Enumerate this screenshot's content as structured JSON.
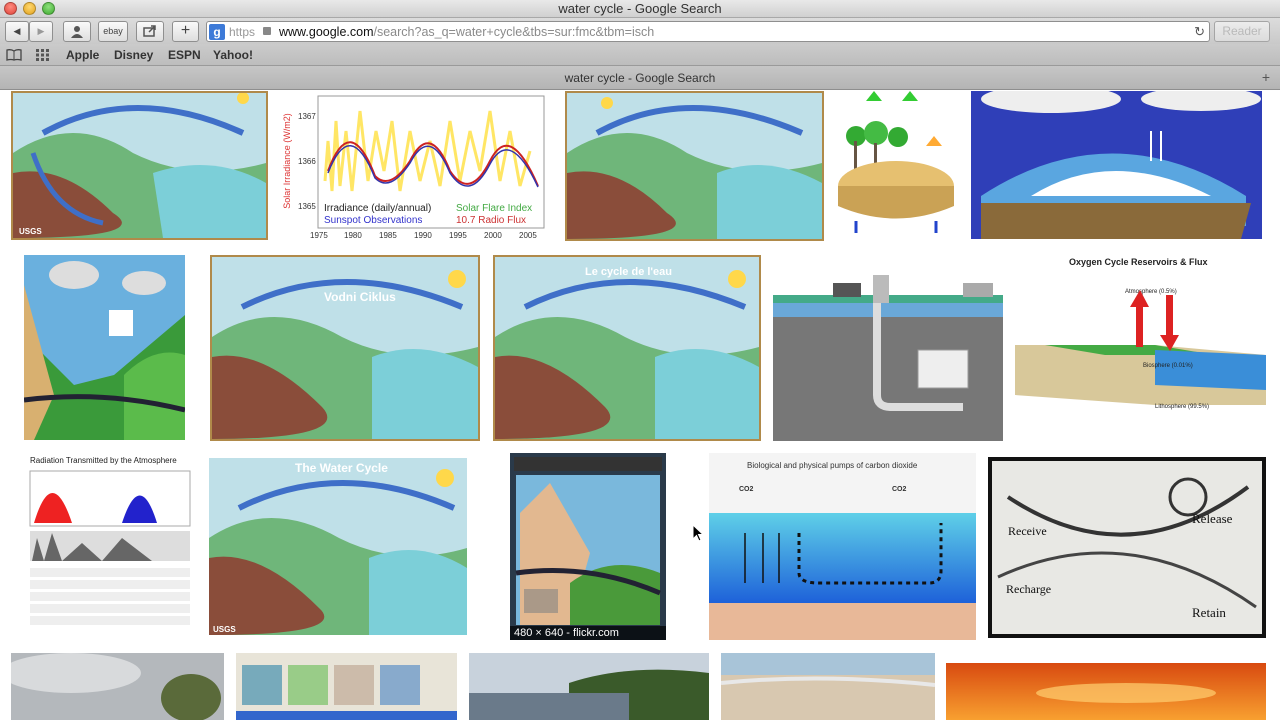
{
  "window": {
    "title": "water cycle - Google Search"
  },
  "toolbar": {
    "back_label": "◀",
    "forward_label": "▶",
    "ebay_label": "ebay",
    "url_scheme": "https",
    "url_host": "www.google.com",
    "url_rest": "/search?as_q=water+cycle&tbs=sur:fmc&tbm=isch",
    "reader_label": "Reader"
  },
  "bookmarks": {
    "items": [
      "Apple",
      "Disney",
      "ESPN",
      "Yahoo!"
    ]
  },
  "tab": {
    "label": "water cycle - Google Search"
  },
  "images": {
    "usgs_label": "USGS",
    "solar": {
      "ylabel": "Solar Irradiance (W/m2)",
      "yticks": [
        "1367",
        "1366",
        "1365"
      ],
      "xticks": [
        "1975",
        "1980",
        "1985",
        "1990",
        "1995",
        "2000",
        "2005"
      ],
      "legend_irr": "Irradiance (daily/annual)",
      "legend_flare": "Solar Flare Index",
      "legend_sunspot": "Sunspot Observations",
      "legend_radio": "10.7 Radio Flux"
    },
    "vodni_title": "Vodni Ciklus",
    "cycle_eau_title": "Le cycle de l'eau",
    "oxygen_title": "Oxygen Cycle Reservoirs & Flux",
    "oxygen_labels": [
      "Atmosphere (0.5%)",
      "Biosphere (0.01%)",
      "Lithosphere (99.5%)"
    ],
    "radiation_title": "Radiation Transmitted by the Atmosphere",
    "water_cycle_title": "The Water Cycle",
    "flickr_caption": "480 × 640 - flickr.com",
    "carbon_title": "Biological and physical pumps of carbon dioxide",
    "carbon_co2": "CO2",
    "poster_words": [
      "Receive",
      "Release",
      "Recharge",
      "Retain"
    ]
  },
  "colors": {
    "accent": "#3d7ad8",
    "ocean": "#2f3fb8",
    "sky": "#5fd0e8"
  }
}
